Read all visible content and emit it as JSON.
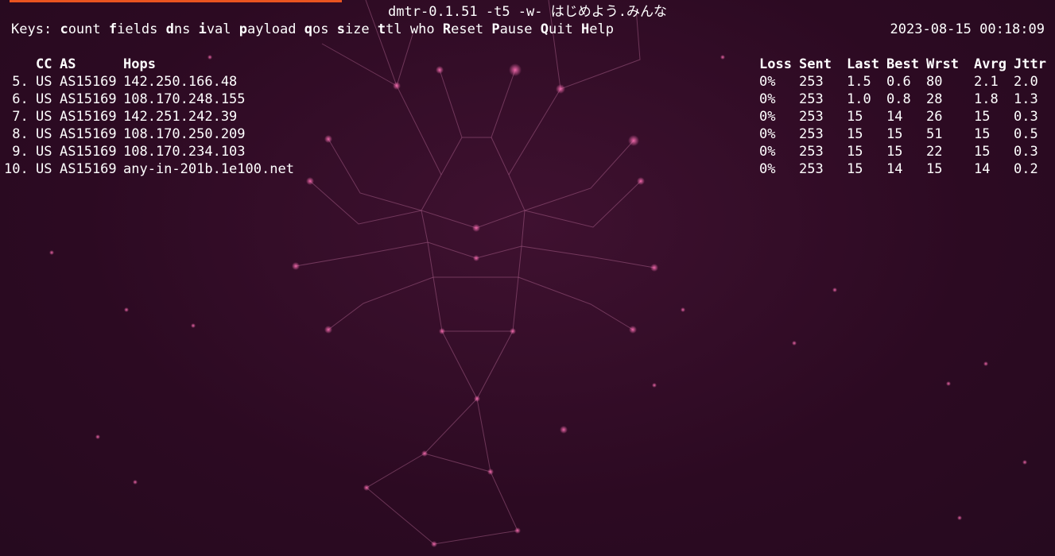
{
  "window": {
    "title": "dmtr-0.1.51 -t5 -w- はじめよう.みんな",
    "timestamp": "2023-08-15 00:18:09"
  },
  "keys": {
    "prefix": "Keys:",
    "items": [
      {
        "hot": "c",
        "rest": "ount",
        "name": "key-count"
      },
      {
        "hot": "f",
        "rest": "ields",
        "name": "key-fields"
      },
      {
        "hot": "d",
        "rest": "ns",
        "name": "key-dns"
      },
      {
        "hot": "i",
        "rest": "val",
        "name": "key-ival"
      },
      {
        "hot": "p",
        "rest": "ayload",
        "name": "key-payload"
      },
      {
        "hot": "q",
        "rest": "os",
        "name": "key-qos"
      },
      {
        "hot": "s",
        "rest": "ize",
        "name": "key-size"
      },
      {
        "hot": "t",
        "rest": "tl",
        "name": "key-ttl"
      },
      {
        "hot": "",
        "rest": "who",
        "name": "key-who"
      },
      {
        "hot": "R",
        "rest": "eset",
        "name": "key-reset"
      },
      {
        "hot": "P",
        "rest": "ause",
        "name": "key-pause"
      },
      {
        "hot": "Q",
        "rest": "uit",
        "name": "key-quit"
      },
      {
        "hot": "H",
        "rest": "elp",
        "name": "key-help"
      }
    ]
  },
  "table": {
    "headers": {
      "cc": "CC",
      "as": "AS",
      "hops": "Hops",
      "loss": "Loss",
      "sent": "Sent",
      "last": "Last",
      "best": "Best",
      "wrst": "Wrst",
      "avrg": "Avrg",
      "jttr": "Jttr"
    },
    "rows": [
      {
        "num": " 5.",
        "cc": "US",
        "as": "AS15169",
        "host": "142.250.166.48",
        "loss": "0%",
        "sent": "253",
        "last": "1.5",
        "best": "0.6",
        "wrst": "80",
        "avrg": "2.1",
        "jttr": "2.0"
      },
      {
        "num": " 6.",
        "cc": "US",
        "as": "AS15169",
        "host": "108.170.248.155",
        "loss": "0%",
        "sent": "253",
        "last": "1.0",
        "best": "0.8",
        "wrst": "28",
        "avrg": "1.8",
        "jttr": "1.3"
      },
      {
        "num": " 7.",
        "cc": "US",
        "as": "AS15169",
        "host": "142.251.242.39",
        "loss": "0%",
        "sent": "253",
        "last": "15",
        "best": "14",
        "wrst": "26",
        "avrg": "15",
        "jttr": "0.3"
      },
      {
        "num": " 8.",
        "cc": "US",
        "as": "AS15169",
        "host": "108.170.250.209",
        "loss": "0%",
        "sent": "253",
        "last": "15",
        "best": "15",
        "wrst": "51",
        "avrg": "15",
        "jttr": "0.5"
      },
      {
        "num": " 9.",
        "cc": "US",
        "as": "AS15169",
        "host": "108.170.234.103",
        "loss": "0%",
        "sent": "253",
        "last": "15",
        "best": "15",
        "wrst": "22",
        "avrg": "15",
        "jttr": "0.3"
      },
      {
        "num": "10.",
        "cc": "US",
        "as": "AS15169",
        "host": "any-in-201b.1e100.net",
        "loss": "0%",
        "sent": "253",
        "last": "15",
        "best": "14",
        "wrst": "15",
        "avrg": "14",
        "jttr": "0.2"
      }
    ]
  },
  "colors": {
    "accent": "#e95420",
    "background": "#2c0a22",
    "text": "#ffffff"
  }
}
